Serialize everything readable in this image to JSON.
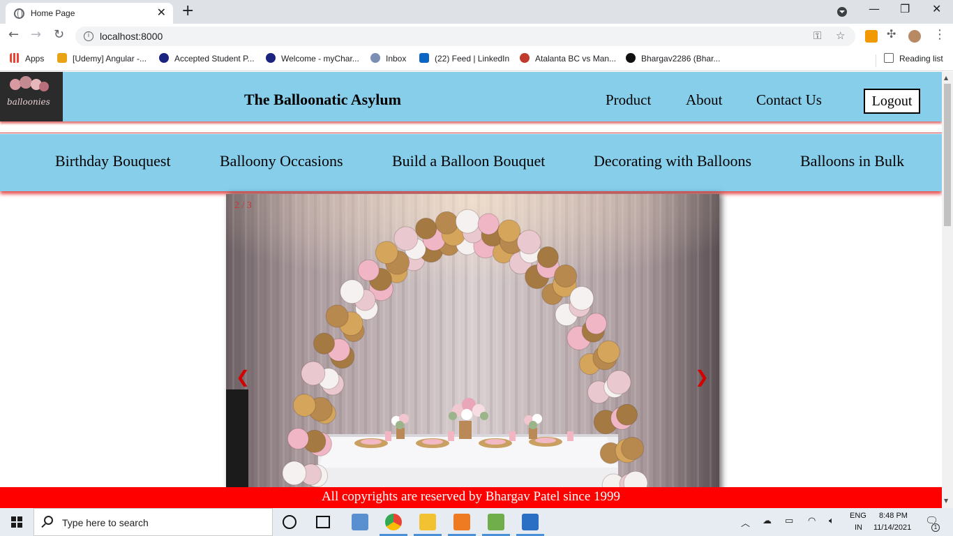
{
  "browser": {
    "tab_title": "Home Page",
    "tab_close": "✕",
    "new_tab": "+",
    "url": "localhost:8000",
    "bookmarks": [
      {
        "label": "Apps",
        "color": "#4285f4"
      },
      {
        "label": "[Udemy] Angular -...",
        "color": "#e8a317"
      },
      {
        "label": "Accepted Student P...",
        "color": "#1a237e"
      },
      {
        "label": "Welcome - myChar...",
        "color": "#1a237e"
      },
      {
        "label": "Inbox",
        "color": "#7a8fb3"
      },
      {
        "label": "(22) Feed | LinkedIn",
        "color": "#0a66c2"
      },
      {
        "label": "Atalanta BC vs Man...",
        "color": "#c0392b"
      },
      {
        "label": "Bhargav2286 (Bhar...",
        "color": "#111111"
      }
    ],
    "reading_list": "Reading list"
  },
  "site": {
    "logo_text": "balloonies",
    "title": "The Balloonatic Asylum",
    "nav": [
      "Product",
      "About",
      "Contact Us"
    ],
    "logout": "Logout",
    "categories": [
      "Birthday Bouquest",
      "Balloony Occasions",
      "Build a Balloon Bouquet",
      "Decorating with Balloons",
      "Balloons in Bulk"
    ],
    "slideshow": {
      "counter": "2 / 3",
      "prev": "❮",
      "next": "❯"
    },
    "footer": "All copyrights are reserved by Bhargav Patel since 1999"
  },
  "taskbar": {
    "search_placeholder": "Type here to search",
    "lang_top": "ENG",
    "lang_bottom": "IN",
    "time": "8:48 PM",
    "date": "11/14/2021",
    "notification_count": "1"
  },
  "colors": {
    "header_bg": "#87ceeb",
    "footer_bg": "#ff0000",
    "accent_shadow": "#cc0000"
  }
}
